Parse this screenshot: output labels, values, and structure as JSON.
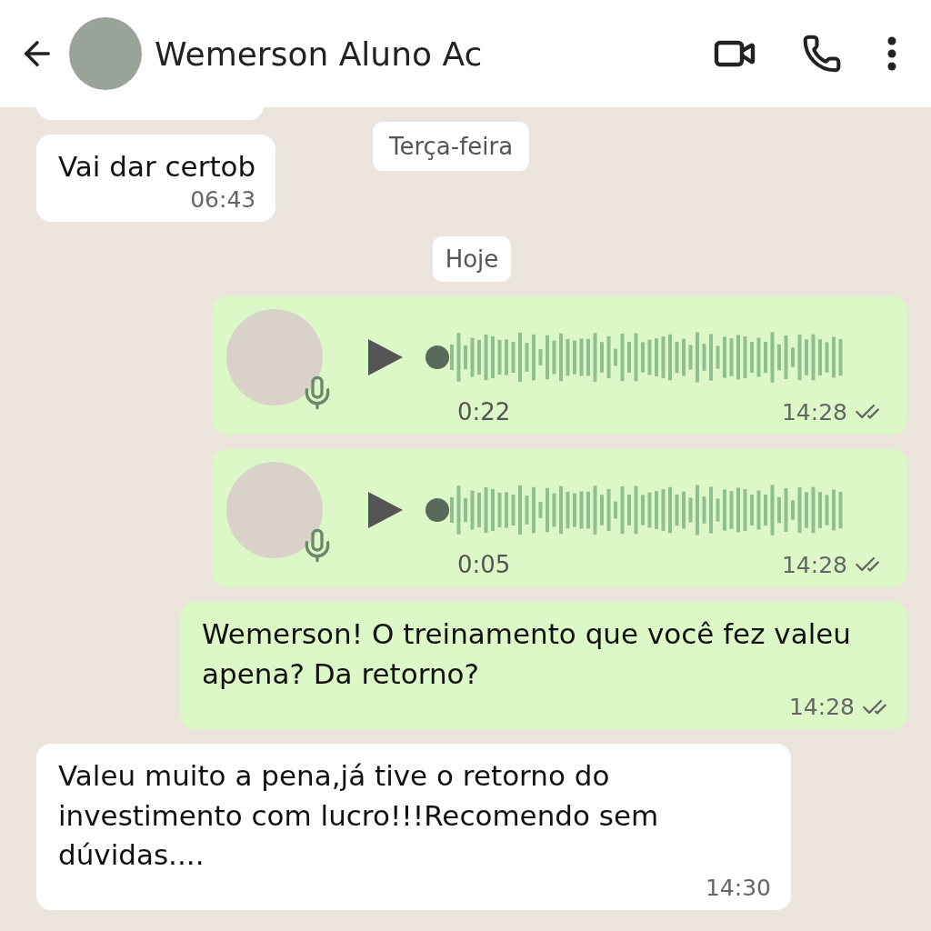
{
  "header": {
    "contact_name": "Wemerson Aluno Ac"
  },
  "floating_date": "Terça-feira",
  "messages": [
    {
      "kind": "incoming",
      "text": "Vai dar certob",
      "time": "06:43"
    },
    {
      "kind": "date",
      "text": "Hoje"
    },
    {
      "kind": "audio",
      "duration": "0:22",
      "time": "14:28",
      "read": true
    },
    {
      "kind": "audio",
      "duration": "0:05",
      "time": "14:28",
      "read": true
    },
    {
      "kind": "outgoing",
      "text": "Wemerson! O treinamento que você fez valeu apena? Da retorno?",
      "time": "14:28",
      "read": true
    },
    {
      "kind": "incoming",
      "text": "Valeu muito a pena,já tive o retorno do investimento com lucro!!!Recomendo sem dúvidas....",
      "time": "14:30"
    }
  ]
}
